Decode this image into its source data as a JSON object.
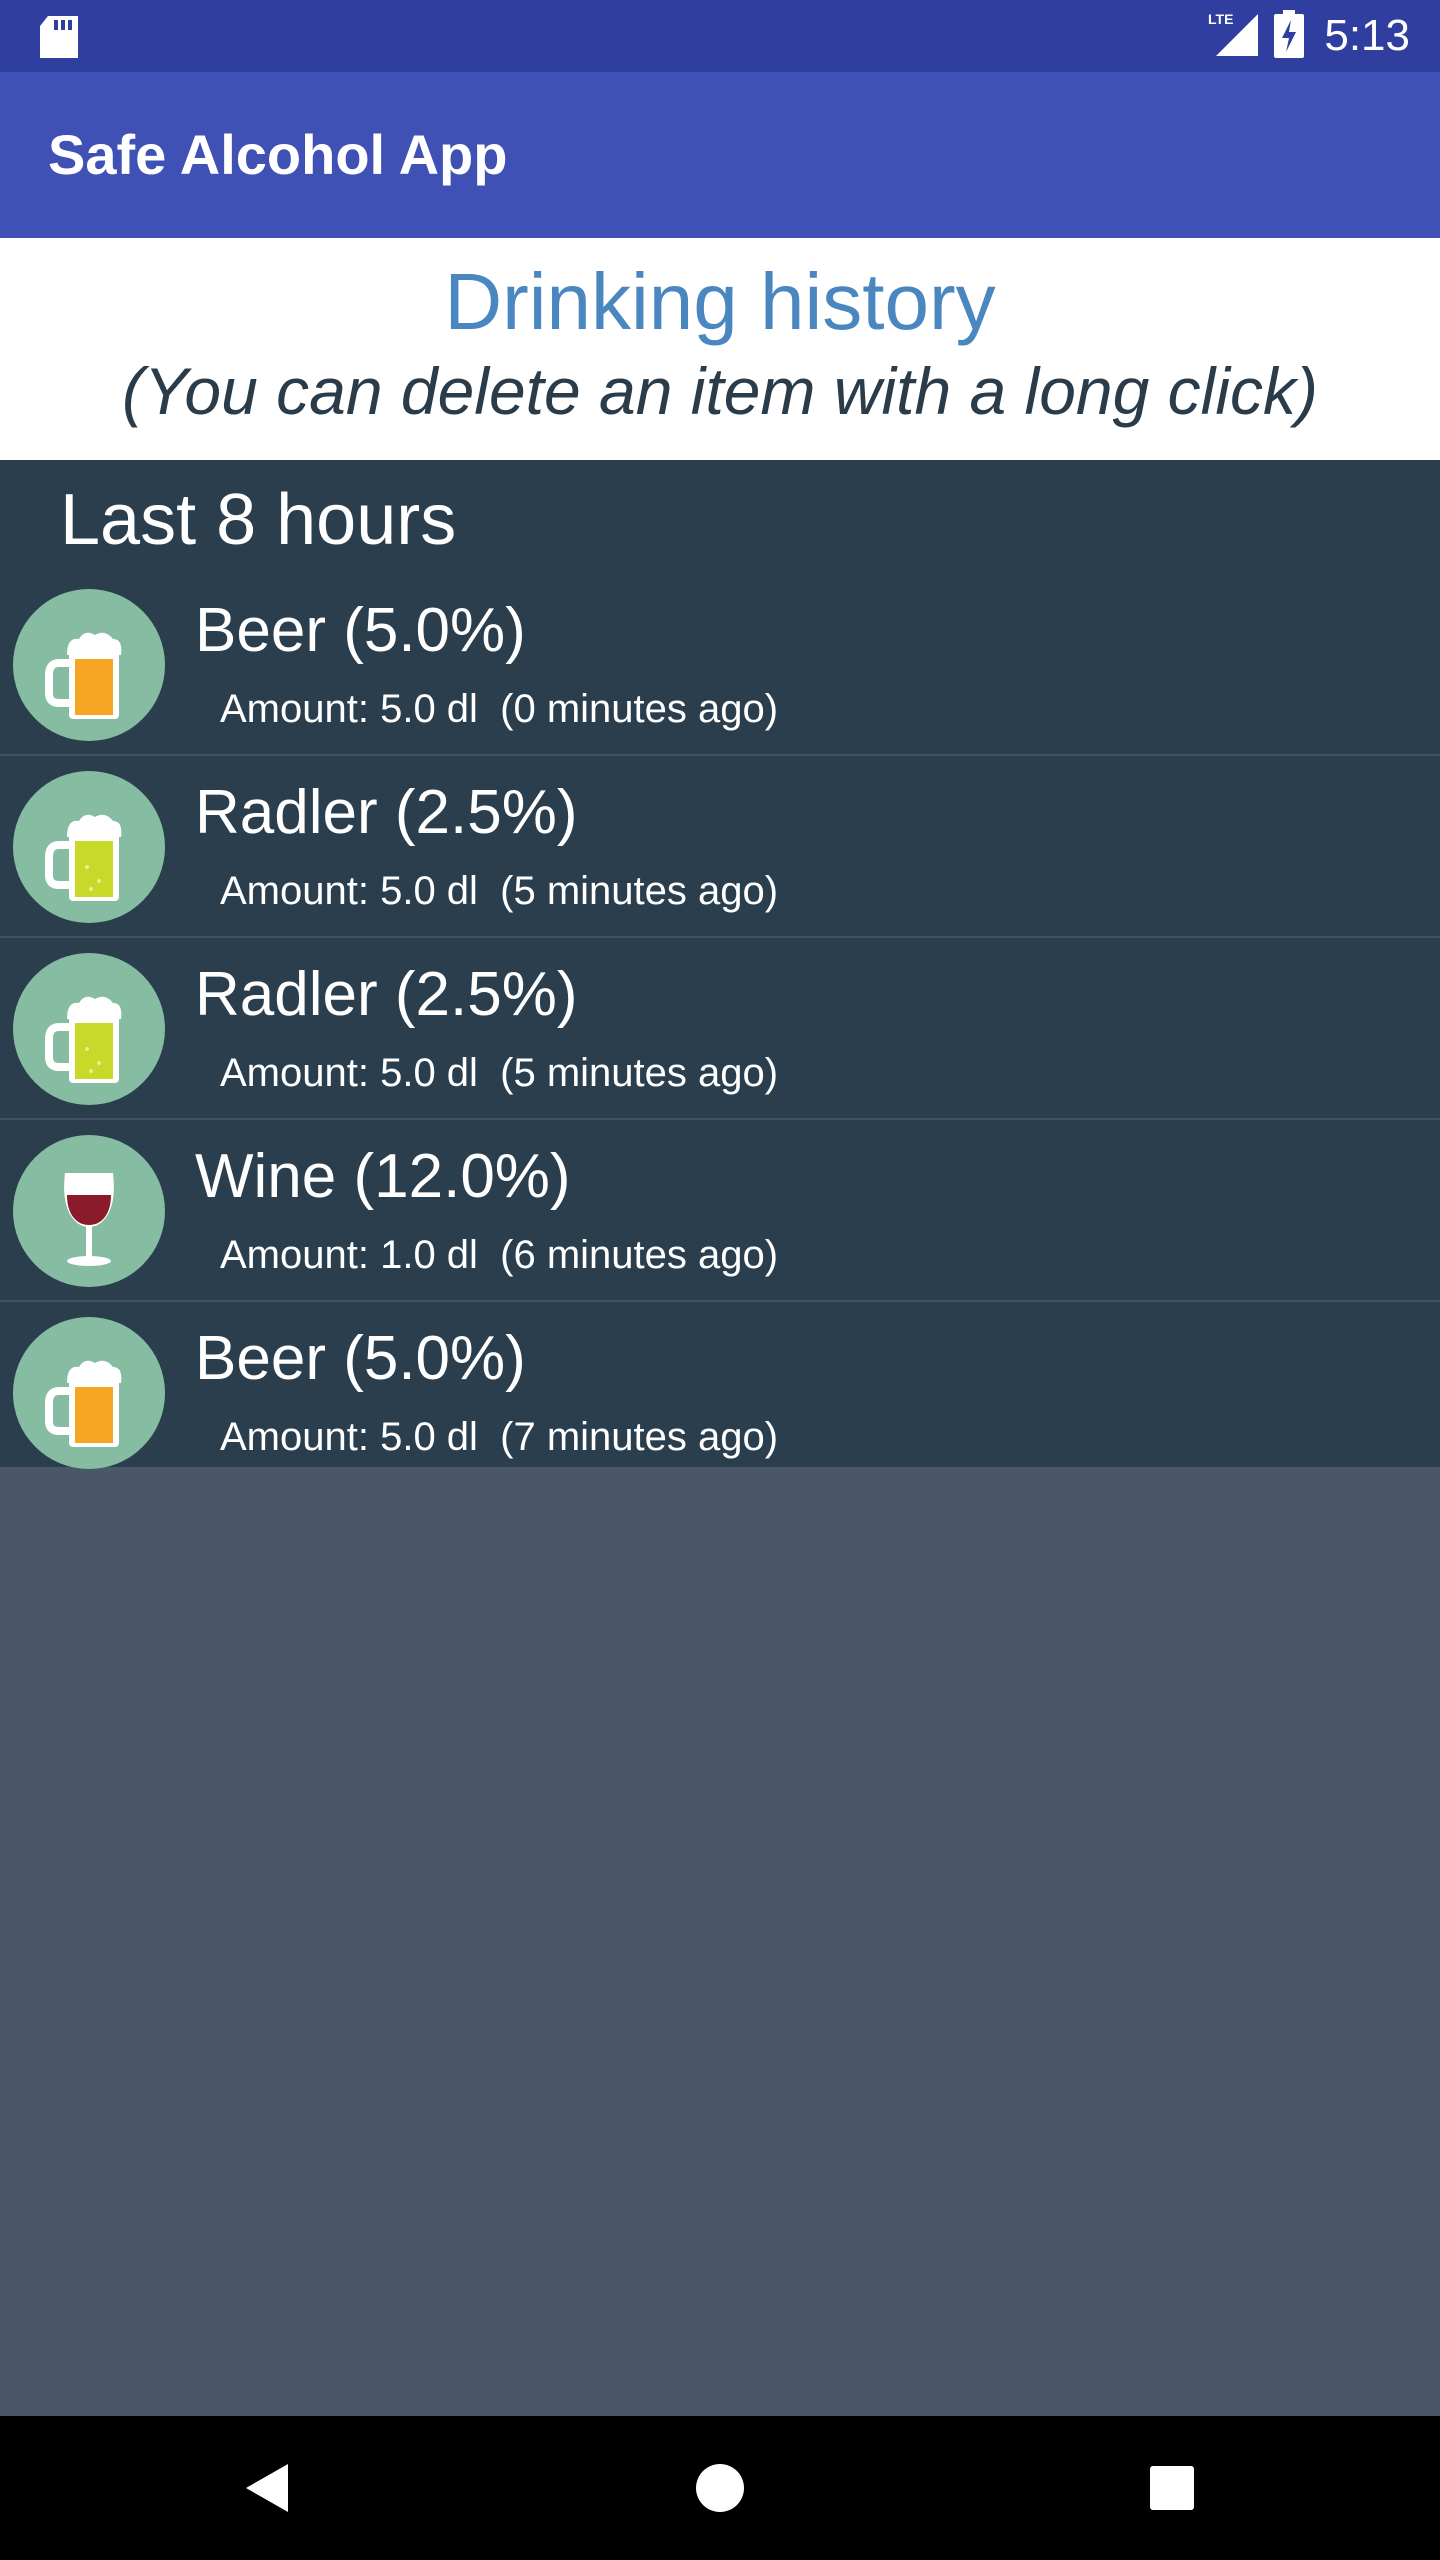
{
  "status_bar": {
    "time": "5:13",
    "network": "LTE",
    "icons": [
      "sd-card-icon",
      "signal-icon",
      "battery-charging-icon"
    ]
  },
  "toolbar": {
    "title": "Safe Alcohol App"
  },
  "header": {
    "title": "Drinking history",
    "subtitle": "(You can delete an item with a long click)"
  },
  "section": {
    "title": "Last 8 hours"
  },
  "items": [
    {
      "icon": "beer-mug-icon",
      "title": "Beer (5.0%)",
      "amount": "Amount: 5.0 dl",
      "ago": "(0 minutes ago)"
    },
    {
      "icon": "radler-mug-icon",
      "title": "Radler (2.5%)",
      "amount": "Amount: 5.0 dl",
      "ago": "(5 minutes ago)"
    },
    {
      "icon": "radler-mug-icon",
      "title": "Radler (2.5%)",
      "amount": "Amount: 5.0 dl",
      "ago": "(5 minutes ago)"
    },
    {
      "icon": "wine-glass-icon",
      "title": "Wine (12.0%)",
      "amount": "Amount: 1.0 dl",
      "ago": "(6 minutes ago)"
    },
    {
      "icon": "beer-mug-icon",
      "title": "Beer (5.0%)",
      "amount": "Amount: 5.0 dl",
      "ago": "(7 minutes ago)"
    }
  ],
  "colors": {
    "status_bar": "#303f9f",
    "toolbar": "#3f51b5",
    "header_title": "#4a86c0",
    "list_bg": "#2a3e4d",
    "empty_bg": "#4a5768",
    "avatar_bg": "#86bda2",
    "beer": "#f5a623",
    "radler": "#c8d92a",
    "wine": "#8b1a2b"
  },
  "navigation": [
    "back-icon",
    "home-icon",
    "recents-icon"
  ]
}
